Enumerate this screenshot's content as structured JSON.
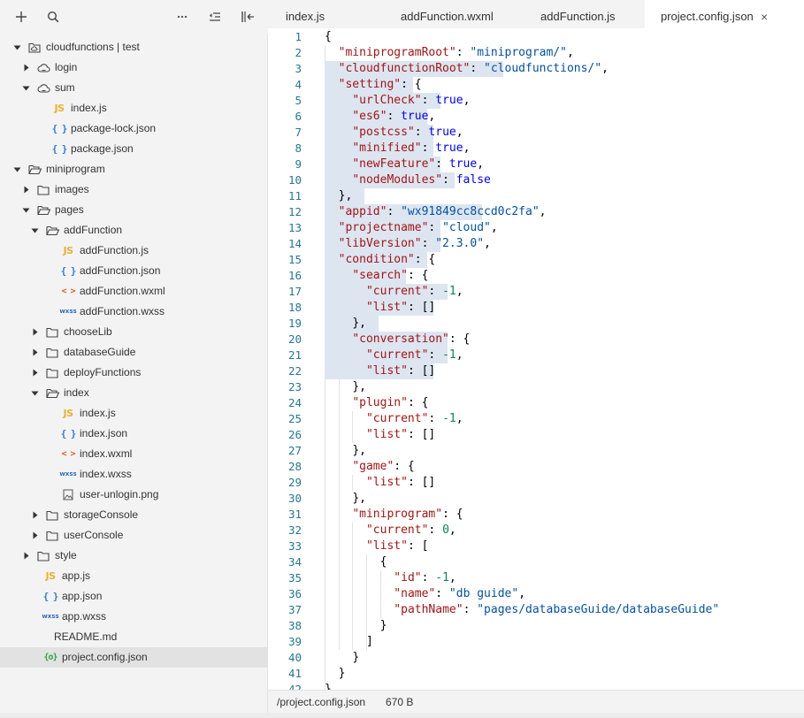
{
  "toolbar": {
    "add": "add-icon",
    "search": "search-icon",
    "more": "more-icon",
    "indent": "outline-icon",
    "collapse": "collapse-panel-icon"
  },
  "tree": [
    {
      "label": "cloudfunctions | test",
      "depth": 0,
      "twisty": "open",
      "icon": "cloud-folder-icon"
    },
    {
      "label": "login",
      "depth": 1,
      "twisty": "closed",
      "icon": "cloud-function-icon"
    },
    {
      "label": "sum",
      "depth": 1,
      "twisty": "open",
      "icon": "cloud-function-icon"
    },
    {
      "label": "index.js",
      "depth": 2,
      "twisty": "none",
      "icon": "js-icon"
    },
    {
      "label": "package-lock.json",
      "depth": 2,
      "twisty": "none",
      "icon": "json-icon"
    },
    {
      "label": "package.json",
      "depth": 2,
      "twisty": "none",
      "icon": "json-icon"
    },
    {
      "label": "miniprogram",
      "depth": 0,
      "twisty": "open",
      "icon": "folder-open-icon"
    },
    {
      "label": "images",
      "depth": 1,
      "twisty": "closed",
      "icon": "folder-icon"
    },
    {
      "label": "pages",
      "depth": 1,
      "twisty": "open",
      "icon": "folder-open-icon"
    },
    {
      "label": "addFunction",
      "depth": 2,
      "twisty": "open",
      "icon": "folder-open-icon"
    },
    {
      "label": "addFunction.js",
      "depth": 3,
      "twisty": "none",
      "icon": "js-icon"
    },
    {
      "label": "addFunction.json",
      "depth": 3,
      "twisty": "none",
      "icon": "json-icon"
    },
    {
      "label": "addFunction.wxml",
      "depth": 3,
      "twisty": "none",
      "icon": "wxml-icon"
    },
    {
      "label": "addFunction.wxss",
      "depth": 3,
      "twisty": "none",
      "icon": "wxss-icon"
    },
    {
      "label": "chooseLib",
      "depth": 2,
      "twisty": "closed",
      "icon": "folder-icon"
    },
    {
      "label": "databaseGuide",
      "depth": 2,
      "twisty": "closed",
      "icon": "folder-icon"
    },
    {
      "label": "deployFunctions",
      "depth": 2,
      "twisty": "closed",
      "icon": "folder-icon"
    },
    {
      "label": "index",
      "depth": 2,
      "twisty": "open",
      "icon": "folder-open-icon"
    },
    {
      "label": "index.js",
      "depth": 3,
      "twisty": "none",
      "icon": "js-icon"
    },
    {
      "label": "index.json",
      "depth": 3,
      "twisty": "none",
      "icon": "json-icon"
    },
    {
      "label": "index.wxml",
      "depth": 3,
      "twisty": "none",
      "icon": "wxml-icon"
    },
    {
      "label": "index.wxss",
      "depth": 3,
      "twisty": "none",
      "icon": "wxss-icon"
    },
    {
      "label": "user-unlogin.png",
      "depth": 3,
      "twisty": "none",
      "icon": "image-file-icon"
    },
    {
      "label": "storageConsole",
      "depth": 2,
      "twisty": "closed",
      "icon": "folder-icon"
    },
    {
      "label": "userConsole",
      "depth": 2,
      "twisty": "closed",
      "icon": "folder-icon"
    },
    {
      "label": "style",
      "depth": 1,
      "twisty": "closed",
      "icon": "folder-icon"
    },
    {
      "label": "app.js",
      "depth": 1,
      "twisty": "none",
      "icon": "js-icon"
    },
    {
      "label": "app.json",
      "depth": 1,
      "twisty": "none",
      "icon": "json-icon"
    },
    {
      "label": "app.wxss",
      "depth": 1,
      "twisty": "none",
      "icon": "wxss-icon"
    },
    {
      "label": "README.md",
      "depth": 1,
      "twisty": "none",
      "icon": "none"
    },
    {
      "label": "project.config.json",
      "depth": 1,
      "twisty": "none",
      "icon": "config-icon",
      "selected": true
    }
  ],
  "tabs": [
    {
      "label": "index.js",
      "active": false
    },
    {
      "label": "addFunction.wxml",
      "active": false
    },
    {
      "label": "addFunction.js",
      "active": false
    },
    {
      "label": "project.config.json",
      "active": true
    }
  ],
  "tab_close_glyph": "×",
  "icon_glyphs": {
    "js": "JS",
    "json": "{ }",
    "wxml": "< >",
    "wxss": "wxss",
    "config": "{o}"
  },
  "code_lines": [
    [
      [
        "p",
        "{"
      ]
    ],
    [
      [
        "k",
        "\"miniprogramRoot\""
      ],
      [
        "p",
        ": "
      ],
      [
        "s",
        "\"miniprogram/\""
      ],
      [
        "p",
        ","
      ]
    ],
    [
      [
        "k",
        "\"cloudfunctionRoot\""
      ],
      [
        "p",
        ": "
      ],
      [
        "s",
        "\"cloudfunctions/\""
      ],
      [
        "p",
        ","
      ]
    ],
    [
      [
        "k",
        "\"setting\""
      ],
      [
        "p",
        ": {"
      ]
    ],
    [
      [
        "k",
        "\"urlCheck\""
      ],
      [
        "p",
        ": "
      ],
      [
        "b",
        "true"
      ],
      [
        "p",
        ","
      ]
    ],
    [
      [
        "k",
        "\"es6\""
      ],
      [
        "p",
        ": "
      ],
      [
        "b",
        "true"
      ],
      [
        "p",
        ","
      ]
    ],
    [
      [
        "k",
        "\"postcss\""
      ],
      [
        "p",
        ": "
      ],
      [
        "b",
        "true"
      ],
      [
        "p",
        ","
      ]
    ],
    [
      [
        "k",
        "\"minified\""
      ],
      [
        "p",
        ": "
      ],
      [
        "b",
        "true"
      ],
      [
        "p",
        ","
      ]
    ],
    [
      [
        "k",
        "\"newFeature\""
      ],
      [
        "p",
        ": "
      ],
      [
        "b",
        "true"
      ],
      [
        "p",
        ","
      ]
    ],
    [
      [
        "k",
        "\"nodeModules\""
      ],
      [
        "p",
        ": "
      ],
      [
        "b",
        "false"
      ]
    ],
    [
      [
        "p",
        "},"
      ]
    ],
    [
      [
        "k",
        "\"appid\""
      ],
      [
        "p",
        ": "
      ],
      [
        "s",
        "\"wx91849cc8ccd0c2fa\""
      ],
      [
        "p",
        ","
      ]
    ],
    [
      [
        "k",
        "\"projectname\""
      ],
      [
        "p",
        ": "
      ],
      [
        "s",
        "\"cloud\""
      ],
      [
        "p",
        ","
      ]
    ],
    [
      [
        "k",
        "\"libVersion\""
      ],
      [
        "p",
        ": "
      ],
      [
        "s",
        "\"2.3.0\""
      ],
      [
        "p",
        ","
      ]
    ],
    [
      [
        "k",
        "\"condition\""
      ],
      [
        "p",
        ": {"
      ]
    ],
    [
      [
        "k",
        "\"search\""
      ],
      [
        "p",
        ": {"
      ]
    ],
    [
      [
        "k",
        "\"current\""
      ],
      [
        "p",
        ": "
      ],
      [
        "n",
        "-1"
      ],
      [
        "p",
        ","
      ]
    ],
    [
      [
        "k",
        "\"list\""
      ],
      [
        "p",
        ": []"
      ]
    ],
    [
      [
        "p",
        "},"
      ]
    ],
    [
      [
        "k",
        "\"conversation\""
      ],
      [
        "p",
        ": {"
      ]
    ],
    [
      [
        "k",
        "\"current\""
      ],
      [
        "p",
        ": "
      ],
      [
        "n",
        "-1"
      ],
      [
        "p",
        ","
      ]
    ],
    [
      [
        "k",
        "\"list\""
      ],
      [
        "p",
        ": []"
      ]
    ],
    [
      [
        "p",
        "},"
      ]
    ],
    [
      [
        "k",
        "\"plugin\""
      ],
      [
        "p",
        ": {"
      ]
    ],
    [
      [
        "k",
        "\"current\""
      ],
      [
        "p",
        ": "
      ],
      [
        "n",
        "-1"
      ],
      [
        "p",
        ","
      ]
    ],
    [
      [
        "k",
        "\"list\""
      ],
      [
        "p",
        ": []"
      ]
    ],
    [
      [
        "p",
        "},"
      ]
    ],
    [
      [
        "k",
        "\"game\""
      ],
      [
        "p",
        ": {"
      ]
    ],
    [
      [
        "k",
        "\"list\""
      ],
      [
        "p",
        ": []"
      ]
    ],
    [
      [
        "p",
        "},"
      ]
    ],
    [
      [
        "k",
        "\"miniprogram\""
      ],
      [
        "p",
        ": {"
      ]
    ],
    [
      [
        "k",
        "\"current\""
      ],
      [
        "p",
        ": "
      ],
      [
        "n",
        "0"
      ],
      [
        "p",
        ","
      ]
    ],
    [
      [
        "k",
        "\"list\""
      ],
      [
        "p",
        ": ["
      ]
    ],
    [
      [
        "p",
        "{"
      ]
    ],
    [
      [
        "k",
        "\"id\""
      ],
      [
        "p",
        ": "
      ],
      [
        "n",
        "-1"
      ],
      [
        "p",
        ","
      ]
    ],
    [
      [
        "k",
        "\"name\""
      ],
      [
        "p",
        ": "
      ],
      [
        "s",
        "\"db guide\""
      ],
      [
        "p",
        ","
      ]
    ],
    [
      [
        "k",
        "\"pathName\""
      ],
      [
        "p",
        ": "
      ],
      [
        "s",
        "\"pages/databaseGuide/databaseGuide\""
      ]
    ],
    [
      [
        "p",
        "}"
      ]
    ],
    [
      [
        "p",
        "]"
      ]
    ],
    [
      [
        "p",
        "}"
      ]
    ],
    [
      [
        "p",
        "}"
      ]
    ],
    [
      [
        "p",
        "}"
      ]
    ]
  ],
  "status": {
    "path": "/project.config.json",
    "size": "670 B"
  },
  "colors": {
    "key": "#a31515",
    "string": "#0451a5",
    "boolean": "#0000ff",
    "number": "#098658",
    "line_number": "#237893",
    "selection": "#dce5f0",
    "sidebar_bg": "#f3f3f3"
  }
}
